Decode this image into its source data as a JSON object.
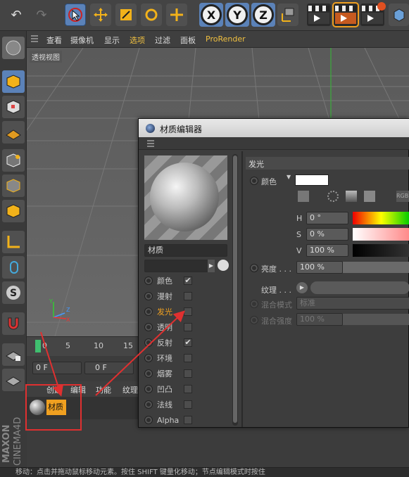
{
  "viewport": {
    "menu": [
      "查看",
      "摄像机",
      "显示",
      "选项",
      "过滤",
      "面板",
      "ProRender"
    ],
    "label": "透视视图"
  },
  "toolbar": {
    "axis_x": "X",
    "axis_y": "Y",
    "axis_z": "Z"
  },
  "timeline": {
    "ticks": [
      "0",
      "5",
      "10",
      "15"
    ],
    "frame_field_1": "0 F",
    "frame_field_2": "0 F"
  },
  "material_manager": {
    "menu": [
      "创建",
      "编辑",
      "功能",
      "纹理"
    ],
    "material_name": "材质"
  },
  "logo": {
    "brand": "MAXON",
    "product": "CINEMA4D"
  },
  "status_bar": "移动：点击并拖动鼠标移动元素。按住 SHIFT 键量化移动；节点编辑模式时按住",
  "editor": {
    "title": "材质编辑器",
    "material_name": "材质",
    "channels": [
      {
        "label": "颜色",
        "checked": true
      },
      {
        "label": "漫射",
        "checked": false
      },
      {
        "label": "发光",
        "checked": false,
        "highlighted": true
      },
      {
        "label": "透明",
        "checked": false
      },
      {
        "label": "反射",
        "checked": true
      },
      {
        "label": "环境",
        "checked": false
      },
      {
        "label": "烟雾",
        "checked": false
      },
      {
        "label": "凹凸",
        "checked": false
      },
      {
        "label": "法线",
        "checked": false
      },
      {
        "label": "Alpha",
        "checked": false
      }
    ],
    "section_title": "发光",
    "color_label": "颜色",
    "h_label": "H",
    "h_value": "0 °",
    "s_label": "S",
    "s_value": "0 %",
    "v_label": "V",
    "v_value": "100 %",
    "brightness_label": "亮度 . . .",
    "brightness_value": "100 %",
    "texture_label": "纹理 . . .",
    "blend_mode_label": "混合模式",
    "blend_mode_value": "标准",
    "blend_strength_label": "混合强度",
    "blend_strength_value": "100 %",
    "rgb_label": "RGB"
  },
  "colors": {
    "accent": "#5b82b8",
    "highlight_orange": "#f0a020",
    "annotation_red": "#e03030"
  }
}
